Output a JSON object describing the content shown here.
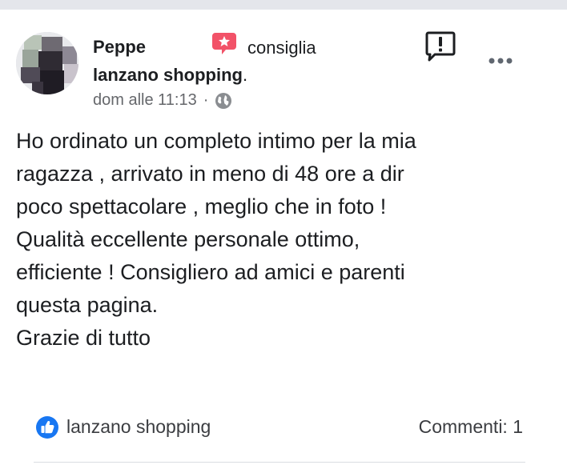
{
  "post": {
    "author_name": "Peppe",
    "action_text": "consiglia",
    "page_name": "lanzano shopping",
    "page_suffix": ".",
    "timestamp": "dom alle 11:13",
    "separator": "·",
    "privacy_icon": "globe-icon",
    "body": "Ho ordinato un completo intimo per la mia\nragazza , arrivato in meno di 48 ore  a dir\npoco spettacolare , meglio che in foto !\nQualità eccellente personale ottimo,\nefficiente ! Consigliero ad amici e parenti\nquesta pagina.\nGrazie di tutto"
  },
  "footer": {
    "reaction_label": "lanzano shopping",
    "reaction_icon": "like-icon",
    "comments_label": "Commenti: 1"
  },
  "colors": {
    "recommend_badge": "#f25268",
    "like_blue": "#1877f2",
    "secondary_text": "#65676b"
  }
}
